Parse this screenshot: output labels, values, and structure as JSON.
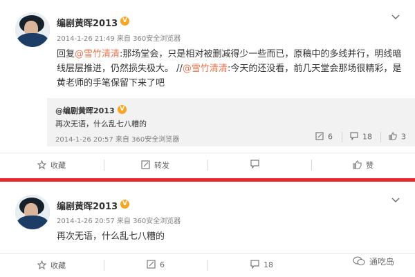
{
  "post1": {
    "author": "编剧黄晖2013",
    "verified_badge": "V",
    "meta": "2014-1-26 21:49 来自 360安全浏览器",
    "body": {
      "prefix": "回复",
      "mention1": "@雪竹清清",
      "text1": ":那场堂会，只是相对被删减得少一些而已，原稿中的多线并行，明线暗线层层推进，仍然损失极大。",
      "sep": " //",
      "mention2": "@雪竹清清",
      "text2": ":今天的还没看，前几天堂会那场很精彩，是黄老师的手笔保留下来了吧"
    },
    "quote": {
      "author": "@编剧黄晖2013",
      "verified_badge": "V",
      "text": "再次无语，什么乱七八糟的",
      "meta": "2014-1-26 20:57 来自 360安全浏览器",
      "repost_count": "6",
      "comment_count": "18",
      "like_count": "3"
    },
    "actions": {
      "favorite_label": "收藏",
      "repost_label": "转发",
      "comment_label": "",
      "like_label": "赞"
    }
  },
  "post2": {
    "author": "编剧黄晖2013",
    "verified_badge": "V",
    "meta": "2014-1-26 20:57 来自 360安全浏览器",
    "body": "再次无语，什么乱七八糟的",
    "actions": {
      "favorite_label": "收藏",
      "repost_count": "6",
      "comment_count": "18"
    }
  },
  "watermark": "通吃岛",
  "colors": {
    "mention": "#eb7350",
    "divider": "#e8272b",
    "badge": "#f6a623",
    "quote_bg": "#f2f2f2"
  },
  "icons": [
    "chevron-down-icon",
    "favorite-icon",
    "repost-icon",
    "comment-icon",
    "like-icon",
    "wechat-icon"
  ]
}
